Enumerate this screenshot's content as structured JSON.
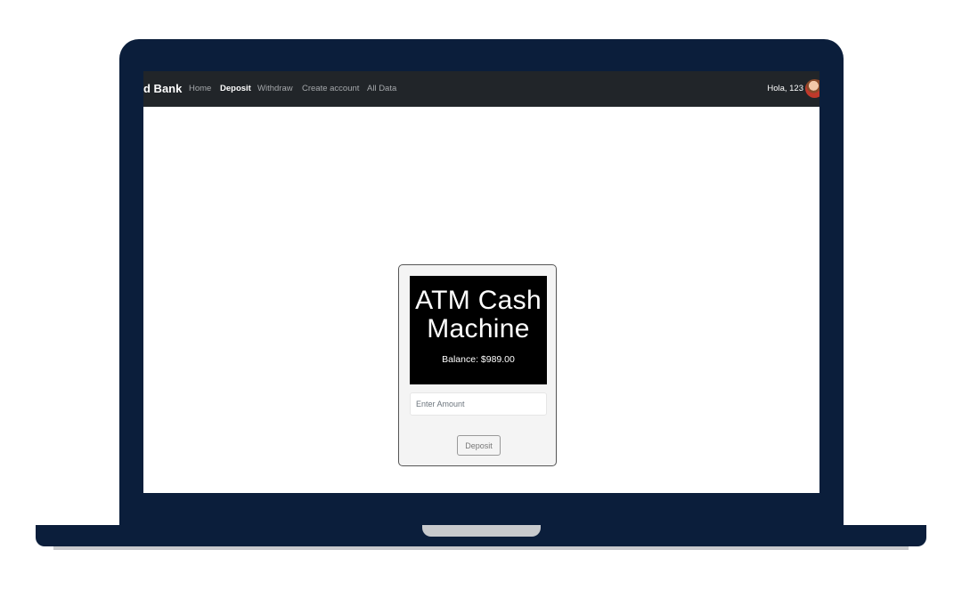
{
  "navbar": {
    "brand": "d Bank",
    "links": [
      "Home",
      "Deposit",
      "Withdraw",
      "Create account",
      "All Data"
    ],
    "active_link": "Deposit",
    "greeting": "Hola, 123"
  },
  "atm": {
    "title": "ATM Cash Machine",
    "balance": "Balance: $989.00",
    "amount_value": "",
    "amount_placeholder": "Enter Amount",
    "button_label": "Deposit"
  },
  "colors": {
    "laptop_frame": "#0b1e3b",
    "navbar_bg": "#212529",
    "atm_screen": "#000000",
    "card_bg": "#f4f4f4"
  }
}
